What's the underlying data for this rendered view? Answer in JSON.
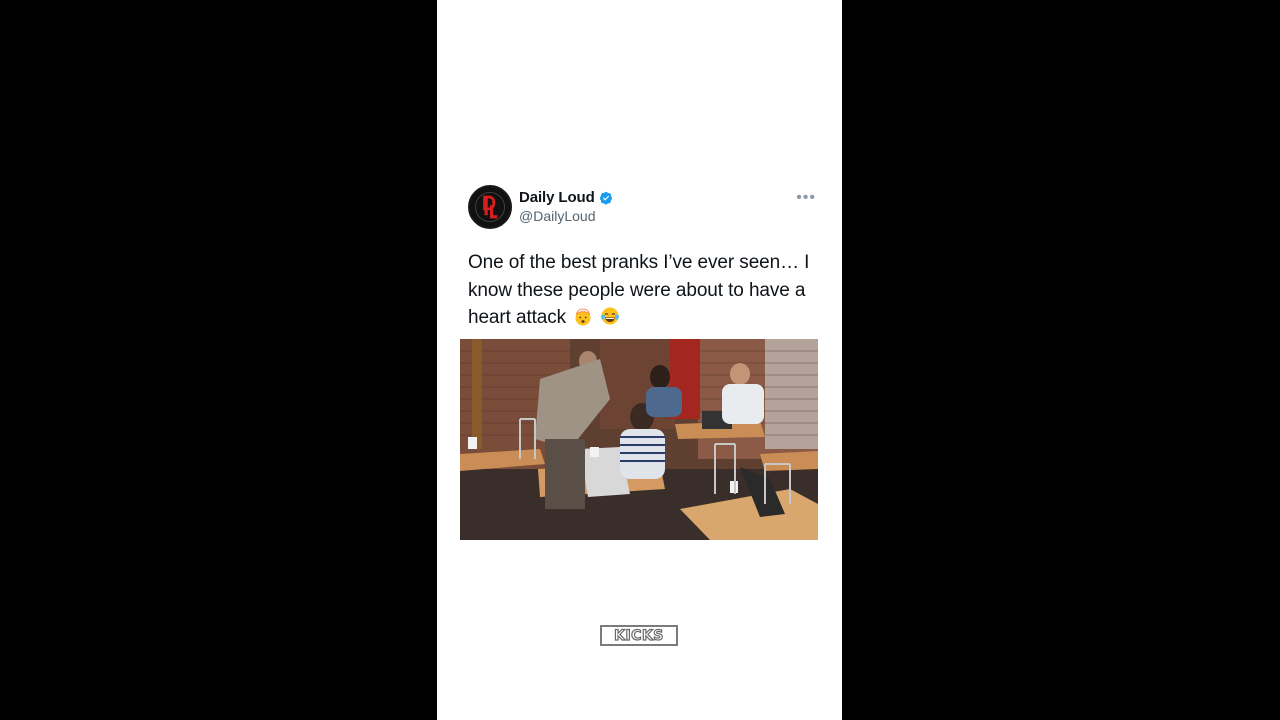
{
  "tweet": {
    "display_name": "Daily Loud",
    "handle": "@DailyLoud",
    "text": "One of the best pranks I’ve ever seen… I know these people were about to have a heart attack",
    "emojis": [
      "exploding-head-emoji",
      "tears-of-joy-emoji"
    ],
    "verified": true,
    "more_menu_icon": "more-dots-icon",
    "media_description_icon": "video-thumbnail"
  },
  "watermark": {
    "label": "KICKS"
  },
  "colors": {
    "background": "#000000",
    "card": "#ffffff",
    "verified": "#1d9bf0",
    "text": "#0f1419",
    "secondary_text": "#536471"
  }
}
